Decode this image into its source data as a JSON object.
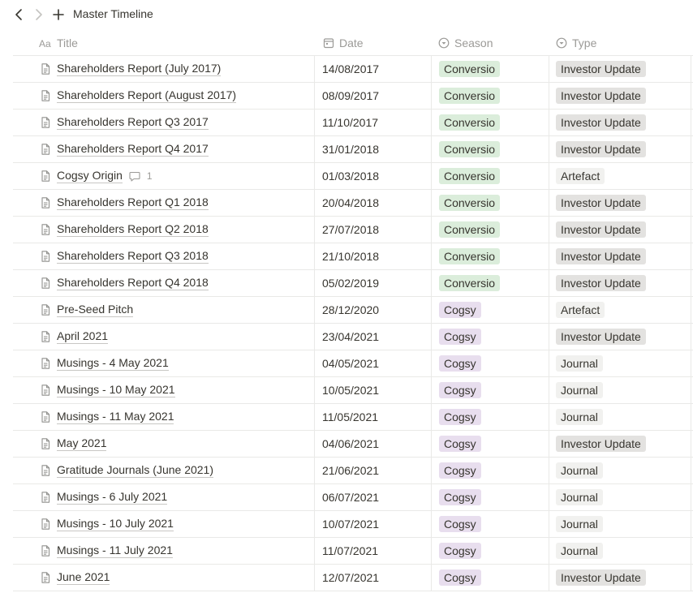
{
  "breadcrumb": {
    "title": "Master Timeline"
  },
  "columns": {
    "title": "Title",
    "date": "Date",
    "season": "Season",
    "type": "Type"
  },
  "colors": {
    "Conversio": "#dbeddb",
    "Cogsy": "#e8deee",
    "Investor Update": "#e3e2e0",
    "Artefact": "#f1f1ef",
    "Journal": "#f1f1ef"
  },
  "rows": [
    {
      "title": "Shareholders Report (July 2017)",
      "date": "14/08/2017",
      "season": "Conversio",
      "type": "Investor Update",
      "comments": ""
    },
    {
      "title": "Shareholders Report (August 2017)",
      "date": "08/09/2017",
      "season": "Conversio",
      "type": "Investor Update",
      "comments": ""
    },
    {
      "title": "Shareholders Report Q3 2017",
      "date": "11/10/2017",
      "season": "Conversio",
      "type": "Investor Update",
      "comments": ""
    },
    {
      "title": "Shareholders Report Q4 2017",
      "date": "31/01/2018",
      "season": "Conversio",
      "type": "Investor Update",
      "comments": ""
    },
    {
      "title": "Cogsy Origin",
      "date": "01/03/2018",
      "season": "Conversio",
      "type": "Artefact",
      "comments": "1"
    },
    {
      "title": "Shareholders Report Q1 2018",
      "date": "20/04/2018",
      "season": "Conversio",
      "type": "Investor Update",
      "comments": ""
    },
    {
      "title": "Shareholders Report Q2 2018",
      "date": "27/07/2018",
      "season": "Conversio",
      "type": "Investor Update",
      "comments": ""
    },
    {
      "title": "Shareholders Report Q3 2018",
      "date": "21/10/2018",
      "season": "Conversio",
      "type": "Investor Update",
      "comments": ""
    },
    {
      "title": "Shareholders Report Q4 2018",
      "date": "05/02/2019",
      "season": "Conversio",
      "type": "Investor Update",
      "comments": ""
    },
    {
      "title": "Pre-Seed Pitch",
      "date": "28/12/2020",
      "season": "Cogsy",
      "type": "Artefact",
      "comments": ""
    },
    {
      "title": "April 2021",
      "date": "23/04/2021",
      "season": "Cogsy",
      "type": "Investor Update",
      "comments": ""
    },
    {
      "title": "Musings - 4 May 2021",
      "date": "04/05/2021",
      "season": "Cogsy",
      "type": "Journal",
      "comments": ""
    },
    {
      "title": "Musings - 10 May 2021",
      "date": "10/05/2021",
      "season": "Cogsy",
      "type": "Journal",
      "comments": ""
    },
    {
      "title": "Musings - 11 May 2021",
      "date": "11/05/2021",
      "season": "Cogsy",
      "type": "Journal",
      "comments": ""
    },
    {
      "title": "May 2021",
      "date": "04/06/2021",
      "season": "Cogsy",
      "type": "Investor Update",
      "comments": ""
    },
    {
      "title": "Gratitude Journals (June 2021)",
      "date": "21/06/2021",
      "season": "Cogsy",
      "type": "Journal",
      "comments": ""
    },
    {
      "title": "Musings - 6 July 2021",
      "date": "06/07/2021",
      "season": "Cogsy",
      "type": "Journal",
      "comments": ""
    },
    {
      "title": "Musings - 10 July 2021",
      "date": "10/07/2021",
      "season": "Cogsy",
      "type": "Journal",
      "comments": ""
    },
    {
      "title": "Musings - 11 July 2021",
      "date": "11/07/2021",
      "season": "Cogsy",
      "type": "Journal",
      "comments": ""
    },
    {
      "title": "June 2021",
      "date": "12/07/2021",
      "season": "Cogsy",
      "type": "Investor Update",
      "comments": ""
    }
  ]
}
